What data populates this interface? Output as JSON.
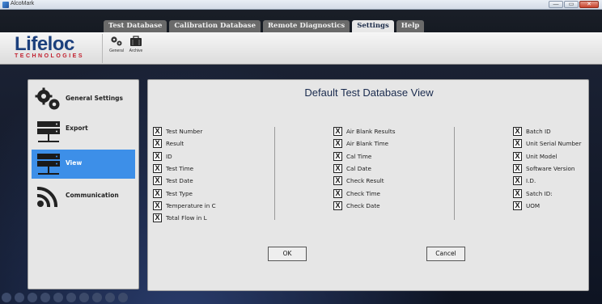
{
  "window": {
    "title": "AlcoMark",
    "controls": [
      "—",
      "▭",
      "✕"
    ]
  },
  "tabs": [
    {
      "label": "Test Database",
      "active": false
    },
    {
      "label": "Calibration Database",
      "active": false
    },
    {
      "label": "Remote Diagnostics",
      "active": false
    },
    {
      "label": "Settings",
      "active": true
    },
    {
      "label": "Help",
      "active": false
    }
  ],
  "logo": {
    "name": "Lifeloc",
    "tagline": "TECHNOLOGIES"
  },
  "ribbon": {
    "general_label": "General",
    "archive_label": "Archive"
  },
  "sidebar": {
    "items": [
      {
        "label": "General Settings",
        "icon": "gears-icon",
        "selected": false
      },
      {
        "label": "Export",
        "icon": "export-icon",
        "selected": false
      },
      {
        "label": "View",
        "icon": "view-icon",
        "selected": true
      },
      {
        "label": "Communication",
        "icon": "wifi-icon",
        "selected": false
      }
    ]
  },
  "panel": {
    "title": "Default Test Database View",
    "columns": [
      [
        {
          "label": "Test Number",
          "checked": "X"
        },
        {
          "label": "Result",
          "checked": "X"
        },
        {
          "label": "ID",
          "checked": "X"
        },
        {
          "label": "Test Time",
          "checked": "X"
        },
        {
          "label": "Test Date",
          "checked": "X"
        },
        {
          "label": "Test Type",
          "checked": "X"
        },
        {
          "label": "Temperature in C",
          "checked": "X"
        },
        {
          "label": "Total Flow in L",
          "checked": "X"
        }
      ],
      [
        {
          "label": "Air Blank Results",
          "checked": "X"
        },
        {
          "label": "Air Blank Time",
          "checked": "X"
        },
        {
          "label": "Cal Time",
          "checked": "X"
        },
        {
          "label": "Cal Date",
          "checked": "X"
        },
        {
          "label": "Check Result",
          "checked": "X"
        },
        {
          "label": "Check Time",
          "checked": "X"
        },
        {
          "label": "Check Date",
          "checked": "X"
        }
      ],
      [
        {
          "label": "Batch ID",
          "checked": "X"
        },
        {
          "label": "Unit Serial Number",
          "checked": "X"
        },
        {
          "label": "Unit Model",
          "checked": "X"
        },
        {
          "label": "Software Version",
          "checked": "X"
        },
        {
          "label": "I.D.",
          "checked": "X"
        },
        {
          "label": "Satch ID:",
          "checked": "X"
        },
        {
          "label": "UOM",
          "checked": "X"
        }
      ]
    ],
    "ok_label": "OK",
    "cancel_label": "Cancel"
  },
  "colors": {
    "selected_nav": "#3d8fe8",
    "logo_blue": "#1b3f7c",
    "logo_red": "#c2202e"
  }
}
